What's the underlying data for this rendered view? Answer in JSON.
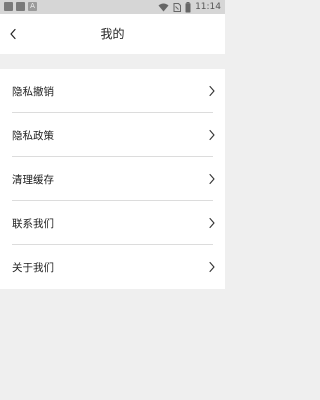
{
  "status_bar": {
    "time": "11:14",
    "left_icons": [
      "notification-icon",
      "notification-icon",
      "a-icon"
    ],
    "left_letter": "A",
    "right_icons": [
      "wifi-icon",
      "sim-icon",
      "battery-icon"
    ]
  },
  "header": {
    "title": "我的",
    "back_icon": "chevron-left-icon"
  },
  "menu": {
    "items": [
      {
        "label": "隐私撤销",
        "icon": "chevron-right-icon"
      },
      {
        "label": "隐私政策",
        "icon": "chevron-right-icon"
      },
      {
        "label": "清理缓存",
        "icon": "chevron-right-icon"
      },
      {
        "label": "联系我们",
        "icon": "chevron-right-icon"
      },
      {
        "label": "关于我们",
        "icon": "chevron-right-icon"
      }
    ]
  },
  "colors": {
    "background": "#efefef",
    "surface": "#ffffff",
    "divider": "#dcdcdc",
    "status_bar": "#d6d6d6"
  }
}
